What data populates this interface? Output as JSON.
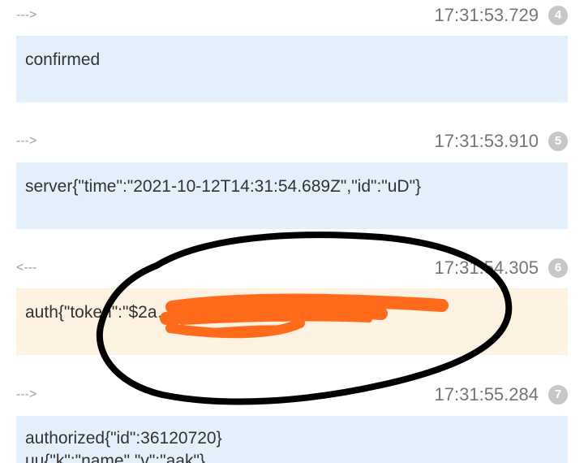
{
  "messages": [
    {
      "direction": "--->",
      "time": "17:31:53.729",
      "index": "4",
      "lines": [
        "confirmed"
      ]
    },
    {
      "direction": "--->",
      "time": "17:31:53.910",
      "index": "5",
      "lines": [
        "server{\"time\":\"2021-10-12T14:31:54.689Z\",\"id\":\"uD\"}"
      ]
    },
    {
      "direction": "<---",
      "time": "17:31:54.305",
      "index": "6",
      "lines": [
        "auth{\"token\":\"$2a……ao.stw8u\"}"
      ]
    },
    {
      "direction": "--->",
      "time": "17:31:55.284",
      "index": "7",
      "lines": [
        "authorized{\"id\":36120720}",
        "uu{\"k\":\"name\",\"v\":\"aak\"}"
      ]
    }
  ],
  "colors": {
    "outgoing_bg": "#e3f0fb",
    "incoming_bg": "#fdf1e1",
    "redaction": "#ff6b1a",
    "circle": "#000000"
  }
}
